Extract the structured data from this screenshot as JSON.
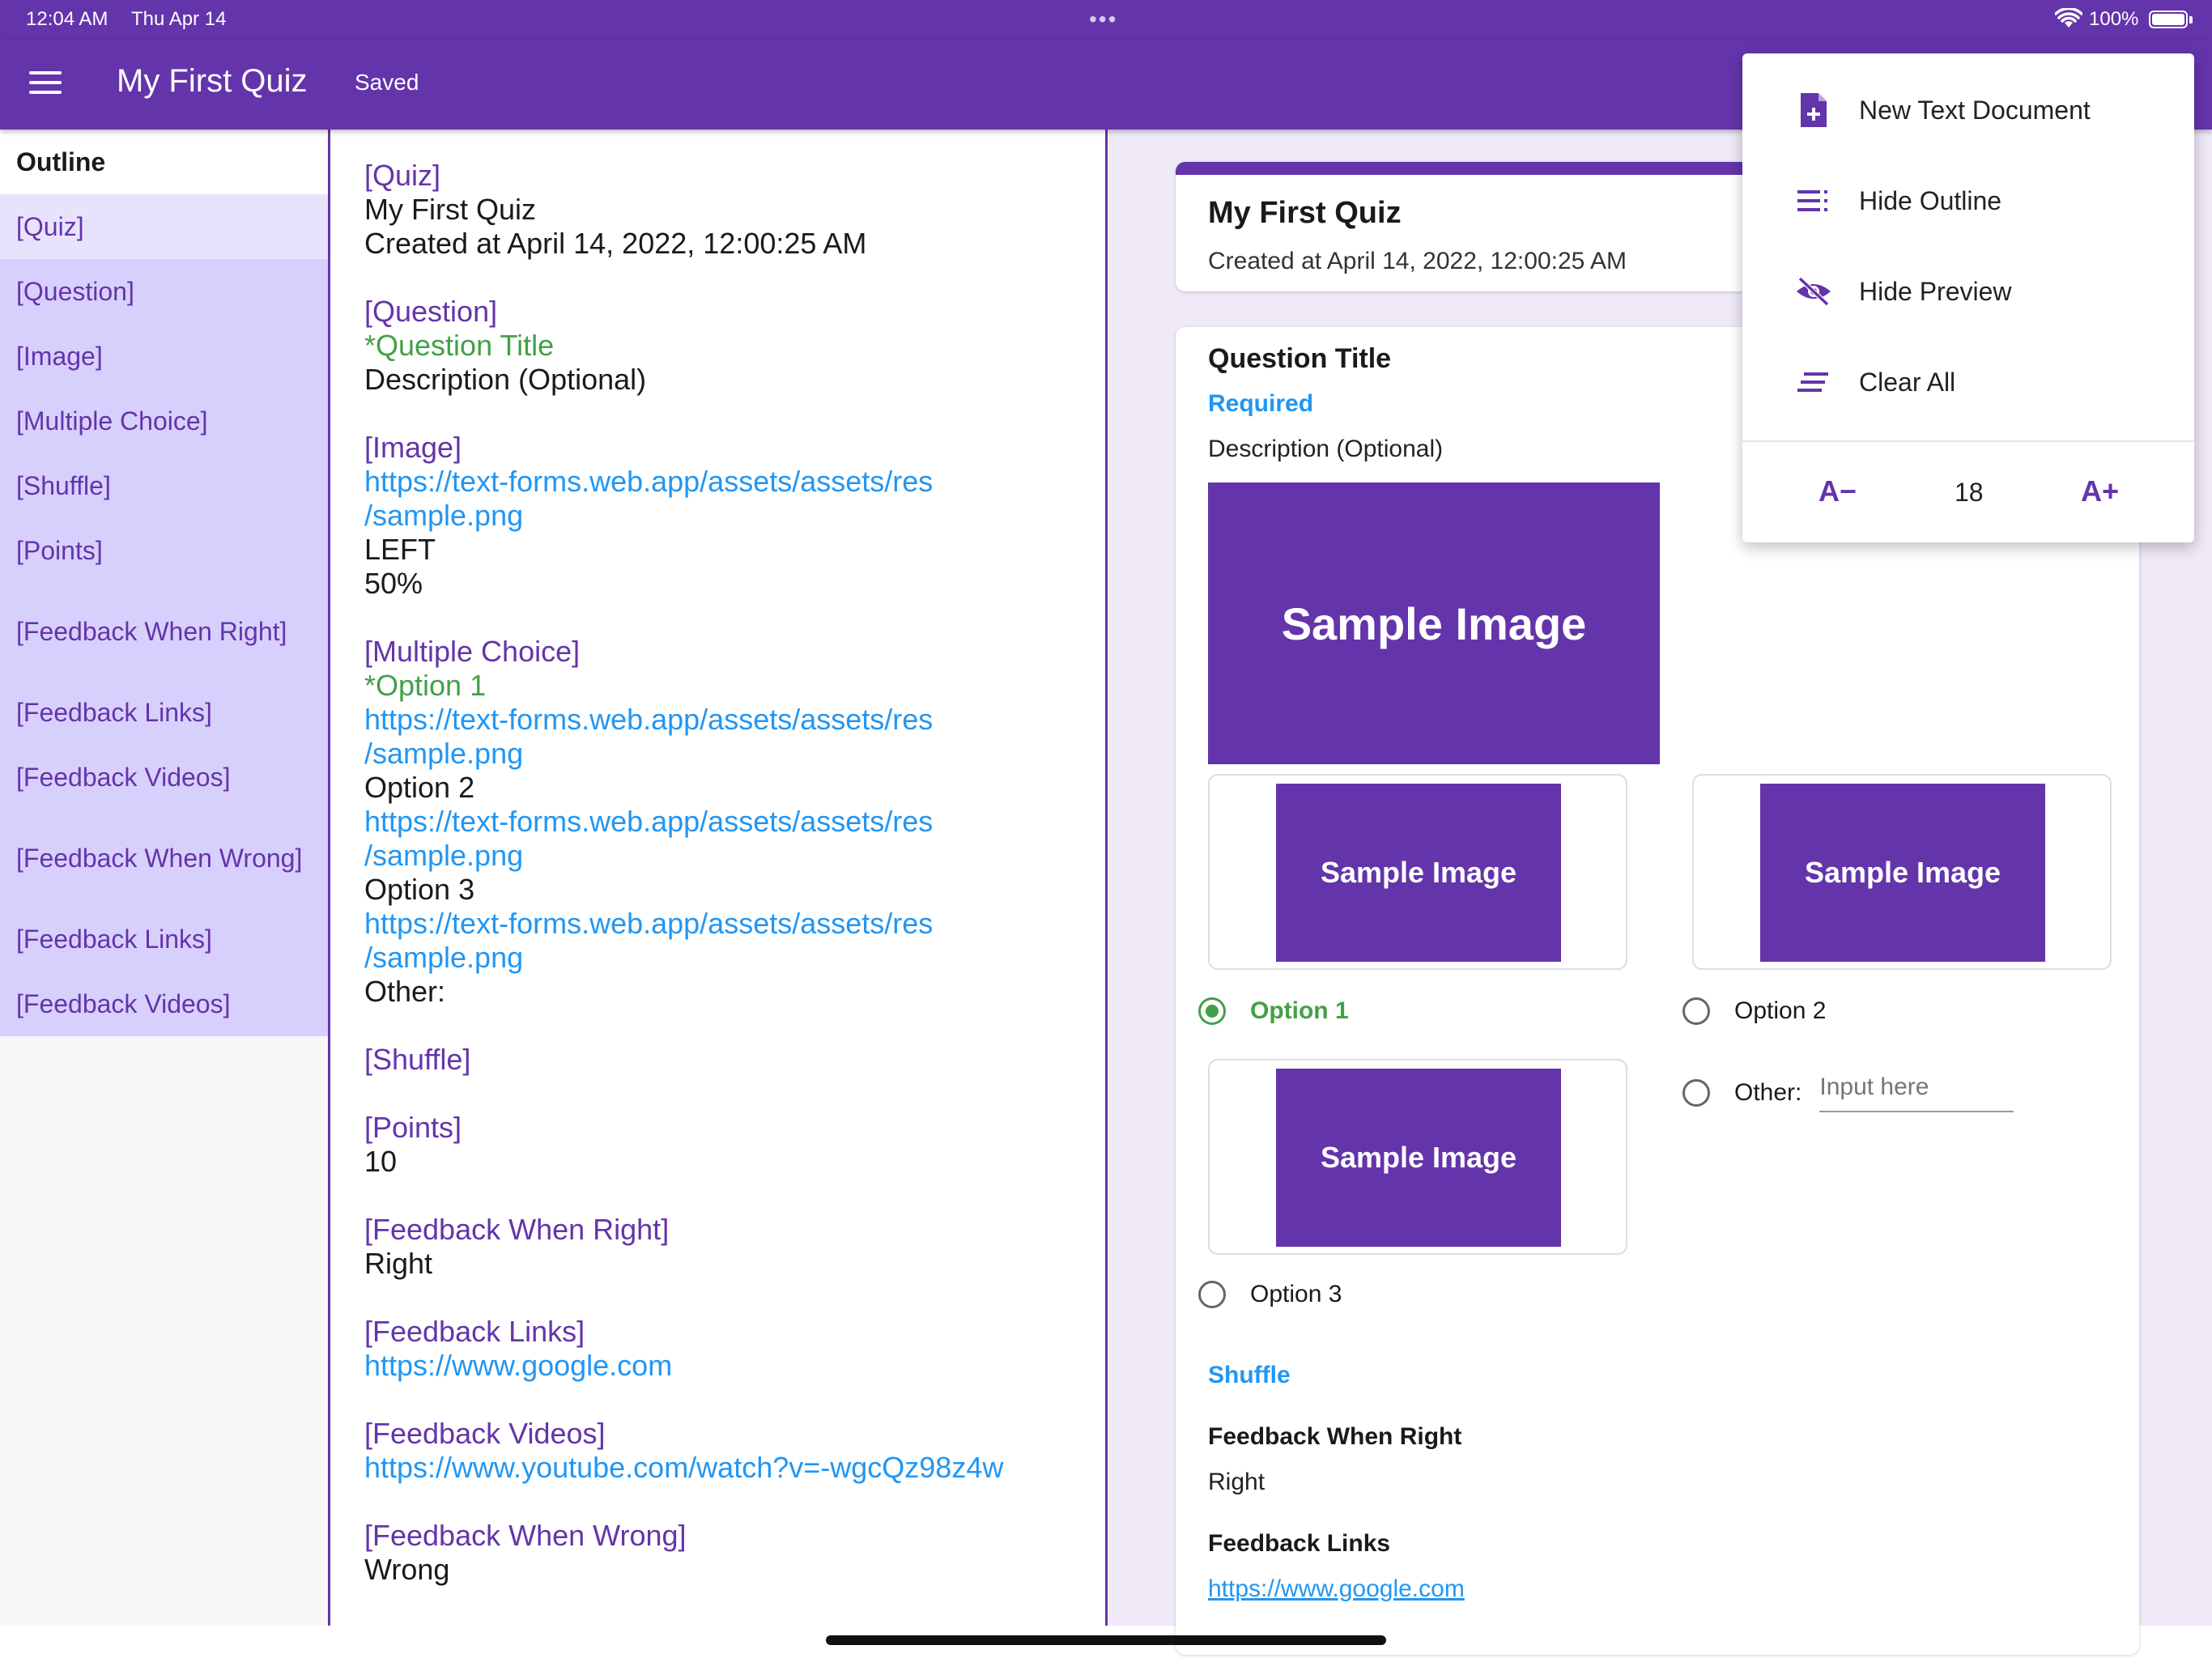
{
  "status_bar": {
    "time": "12:04 AM",
    "date": "Thu Apr 14",
    "dots": "•••",
    "battery": "100%"
  },
  "app_bar": {
    "title": "My First Quiz",
    "status": "Saved"
  },
  "outline": {
    "heading": "Outline",
    "items": [
      {
        "label": "[Quiz]"
      },
      {
        "label": "[Question]"
      },
      {
        "label": "[Image]"
      },
      {
        "label": "[Multiple Choice]"
      },
      {
        "label": "[Shuffle]"
      },
      {
        "label": "[Points]"
      },
      {
        "label": "[Feedback When Right]"
      },
      {
        "label": "[Feedback Links]"
      },
      {
        "label": "[Feedback Videos]"
      },
      {
        "label": "[Feedback When Wrong]"
      },
      {
        "label": "[Feedback Links]"
      },
      {
        "label": "[Feedback Videos]"
      }
    ]
  },
  "editor": {
    "quiz_tag": "[Quiz]",
    "quiz_title": "My First Quiz",
    "quiz_created": "Created at April 14, 2022, 12:00:25 AM",
    "question_tag": "[Question]",
    "question_title": "*Question Title",
    "question_desc": "Description (Optional)",
    "image_tag": "[Image]",
    "image_url_1": "https://text-forms.web.app/assets/assets/res",
    "image_url_2": "/sample.png",
    "image_align": "LEFT",
    "image_width": "50%",
    "mc_tag": "[Multiple Choice]",
    "option1": "*Option 1",
    "option2": "Option 2",
    "option3": "Option 3",
    "url_1": "https://text-forms.web.app/assets/assets/res",
    "url_2": "/sample.png",
    "other": "Other:",
    "shuffle_tag": "[Shuffle]",
    "points_tag": "[Points]",
    "points_value": "10",
    "fb_right_tag": "[Feedback When Right]",
    "fb_right_value": "Right",
    "fb_links_tag": "[Feedback Links]",
    "fb_links_value": "https://www.google.com",
    "fb_videos_tag": "[Feedback Videos]",
    "fb_videos_value": "https://www.youtube.com/watch?v=-wgcQz98z4w",
    "fb_wrong_tag": "[Feedback When Wrong]",
    "fb_wrong_value": "Wrong"
  },
  "preview": {
    "header_title": "My First Quiz",
    "header_subtitle": "Created at April 14, 2022, 12:00:25 AM",
    "question_title": "Question Title",
    "required_label": "Required",
    "description": "Description (Optional)",
    "main_image_text": "Sample Image",
    "option_image_text": "Sample Image",
    "options": [
      {
        "label": "Option 1",
        "checked": true
      },
      {
        "label": "Option 2",
        "checked": false
      },
      {
        "label": "Option 3",
        "checked": false
      }
    ],
    "other_label": "Other:",
    "other_placeholder": "Input here",
    "shuffle_label": "Shuffle",
    "fb_right_label": "Feedback When Right",
    "fb_right_value": "Right",
    "fb_links_label": "Feedback Links",
    "fb_links_value": "https://www.google.com"
  },
  "menu": {
    "new_doc": "New Text Document",
    "hide_outline": "Hide Outline",
    "hide_preview": "Hide Preview",
    "clear_all": "Clear All",
    "font_decrease": "A−",
    "font_size": "18",
    "font_increase": "A+"
  },
  "colors": {
    "primary": "#6434ab",
    "outline_bg": "#d8d0fc",
    "preview_bg": "#efe9f8",
    "link": "#2196f3",
    "required": "#43a047"
  }
}
